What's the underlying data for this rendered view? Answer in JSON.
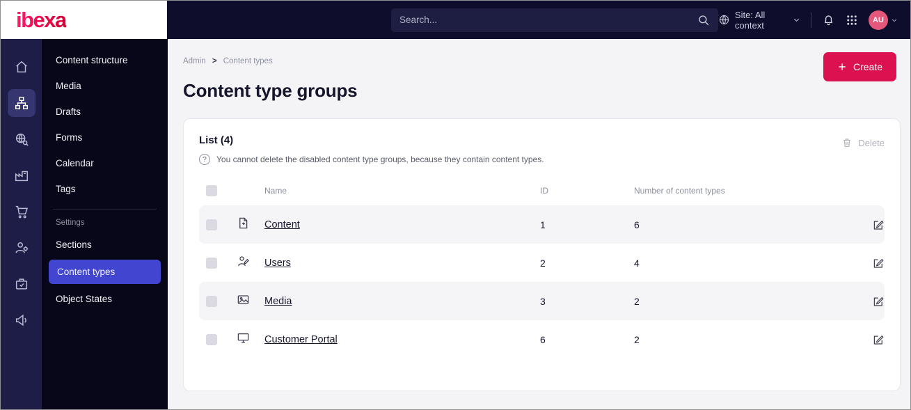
{
  "topbar": {
    "logo_text": "ibexa",
    "search_placeholder": "Search...",
    "site_context_label": "Site: All context",
    "avatar_initials": "AU"
  },
  "sidebar": {
    "icon_items": [
      "home",
      "content-structure",
      "search",
      "product-catalog",
      "commerce",
      "personalization",
      "admin",
      "marketing"
    ],
    "menu_items": [
      "Content structure",
      "Media",
      "Drafts",
      "Forms",
      "Calendar",
      "Tags"
    ],
    "settings_heading": "Settings",
    "settings_items": [
      "Sections",
      "Content types",
      "Object States"
    ],
    "active_item": "Content types"
  },
  "main": {
    "breadcrumb": {
      "items": [
        "Admin",
        "Content types"
      ],
      "separator": ">"
    },
    "create_label": "Create",
    "page_title": "Content type groups",
    "card": {
      "list_title": "List (4)",
      "help_glyph": "?",
      "help_text": "You cannot delete the disabled content type groups, because they contain content types.",
      "delete_label": "Delete",
      "table": {
        "headers": {
          "name": "Name",
          "id": "ID",
          "count": "Number of content types"
        },
        "rows": [
          {
            "icon": "file-icon",
            "name": "Content",
            "id": "1",
            "count": "6"
          },
          {
            "icon": "user-edit-icon",
            "name": "Users",
            "id": "2",
            "count": "4"
          },
          {
            "icon": "image-icon",
            "name": "Media",
            "id": "3",
            "count": "2"
          },
          {
            "icon": "monitor-icon",
            "name": "Customer Portal",
            "id": "6",
            "count": "2"
          }
        ]
      }
    }
  },
  "colors": {
    "accent": "#dc1150",
    "active_blue": "#4245cf",
    "topbar_bg": "#0e0e2c"
  }
}
